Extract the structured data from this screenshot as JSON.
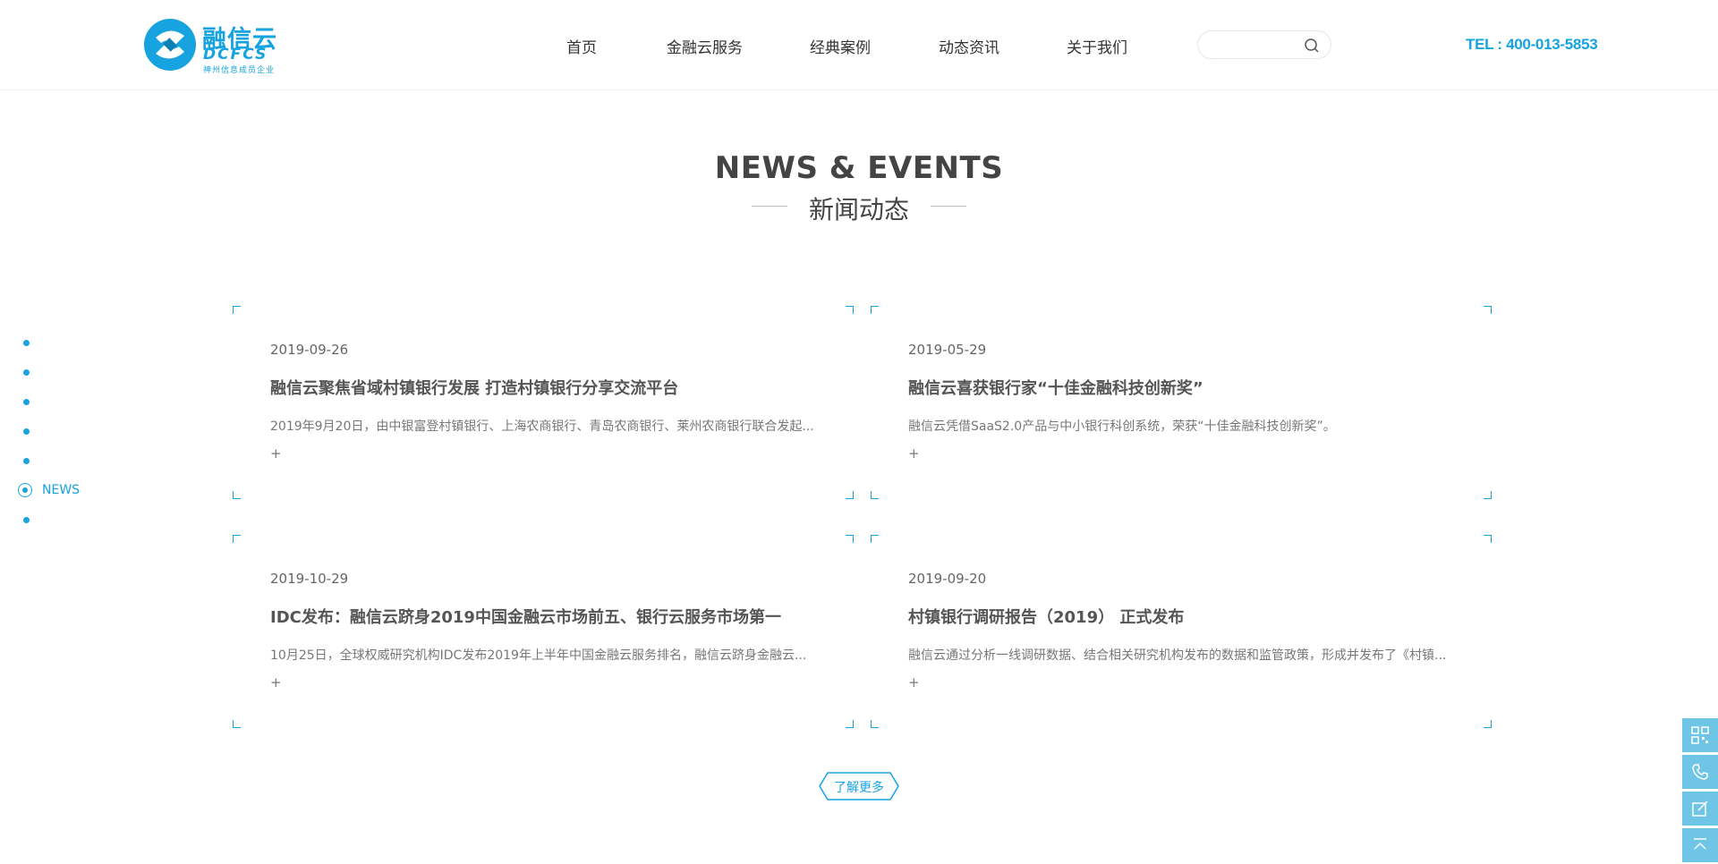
{
  "header": {
    "logo": {
      "cn": "融信云",
      "en": "DCFCS",
      "sub": "神州信息成员企业"
    },
    "nav": [
      {
        "label": "首页"
      },
      {
        "label": "金融云服务"
      },
      {
        "label": "经典案例"
      },
      {
        "label": "动态资讯"
      },
      {
        "label": "关于我们"
      }
    ],
    "search": {
      "value": "",
      "placeholder": ""
    },
    "tel": "TEL : 400-013-5853"
  },
  "section": {
    "title": "NEWS & EVENTS",
    "subtitle": "新闻动态"
  },
  "side_nav": {
    "active_label": "NEWS"
  },
  "news": [
    {
      "date": "2019-09-26",
      "title": "融信云聚焦省域村镇银行发展 打造村镇银行分享交流平台",
      "desc": "2019年9月20日，由中银富登村镇银行、上海农商银行、青岛农商银行、莱州农商银行联合发起...",
      "more": "+"
    },
    {
      "date": "2019-05-29",
      "title": "融信云喜获银行家“十佳金融科技创新奖”",
      "desc": "融信云凭借SaaS2.0产品与中小银行科创系统，荣获“十佳金融科技创新奖”。",
      "more": "+"
    },
    {
      "date": "2019-10-29",
      "title": "IDC发布：融信云跻身2019中国金融云市场前五、银行云服务市场第一",
      "desc": "10月25日，全球权威研究机构IDC发布2019年上半年中国金融云服务排名，融信云跻身金融云...",
      "more": "+"
    },
    {
      "date": "2019-09-20",
      "title": "村镇银行调研报告（2019） 正式发布",
      "desc": "融信云通过分析一线调研数据、结合相关研究机构发布的数据和监管政策，形成并发布了《村镇...",
      "more": "+"
    }
  ],
  "more_button": "了解更多",
  "colors": {
    "accent": "#16a3e0",
    "tool_bg": "#6ec5e6"
  },
  "tools": [
    "qrcode-icon",
    "phone-icon",
    "edit-icon",
    "back-to-top-icon"
  ]
}
